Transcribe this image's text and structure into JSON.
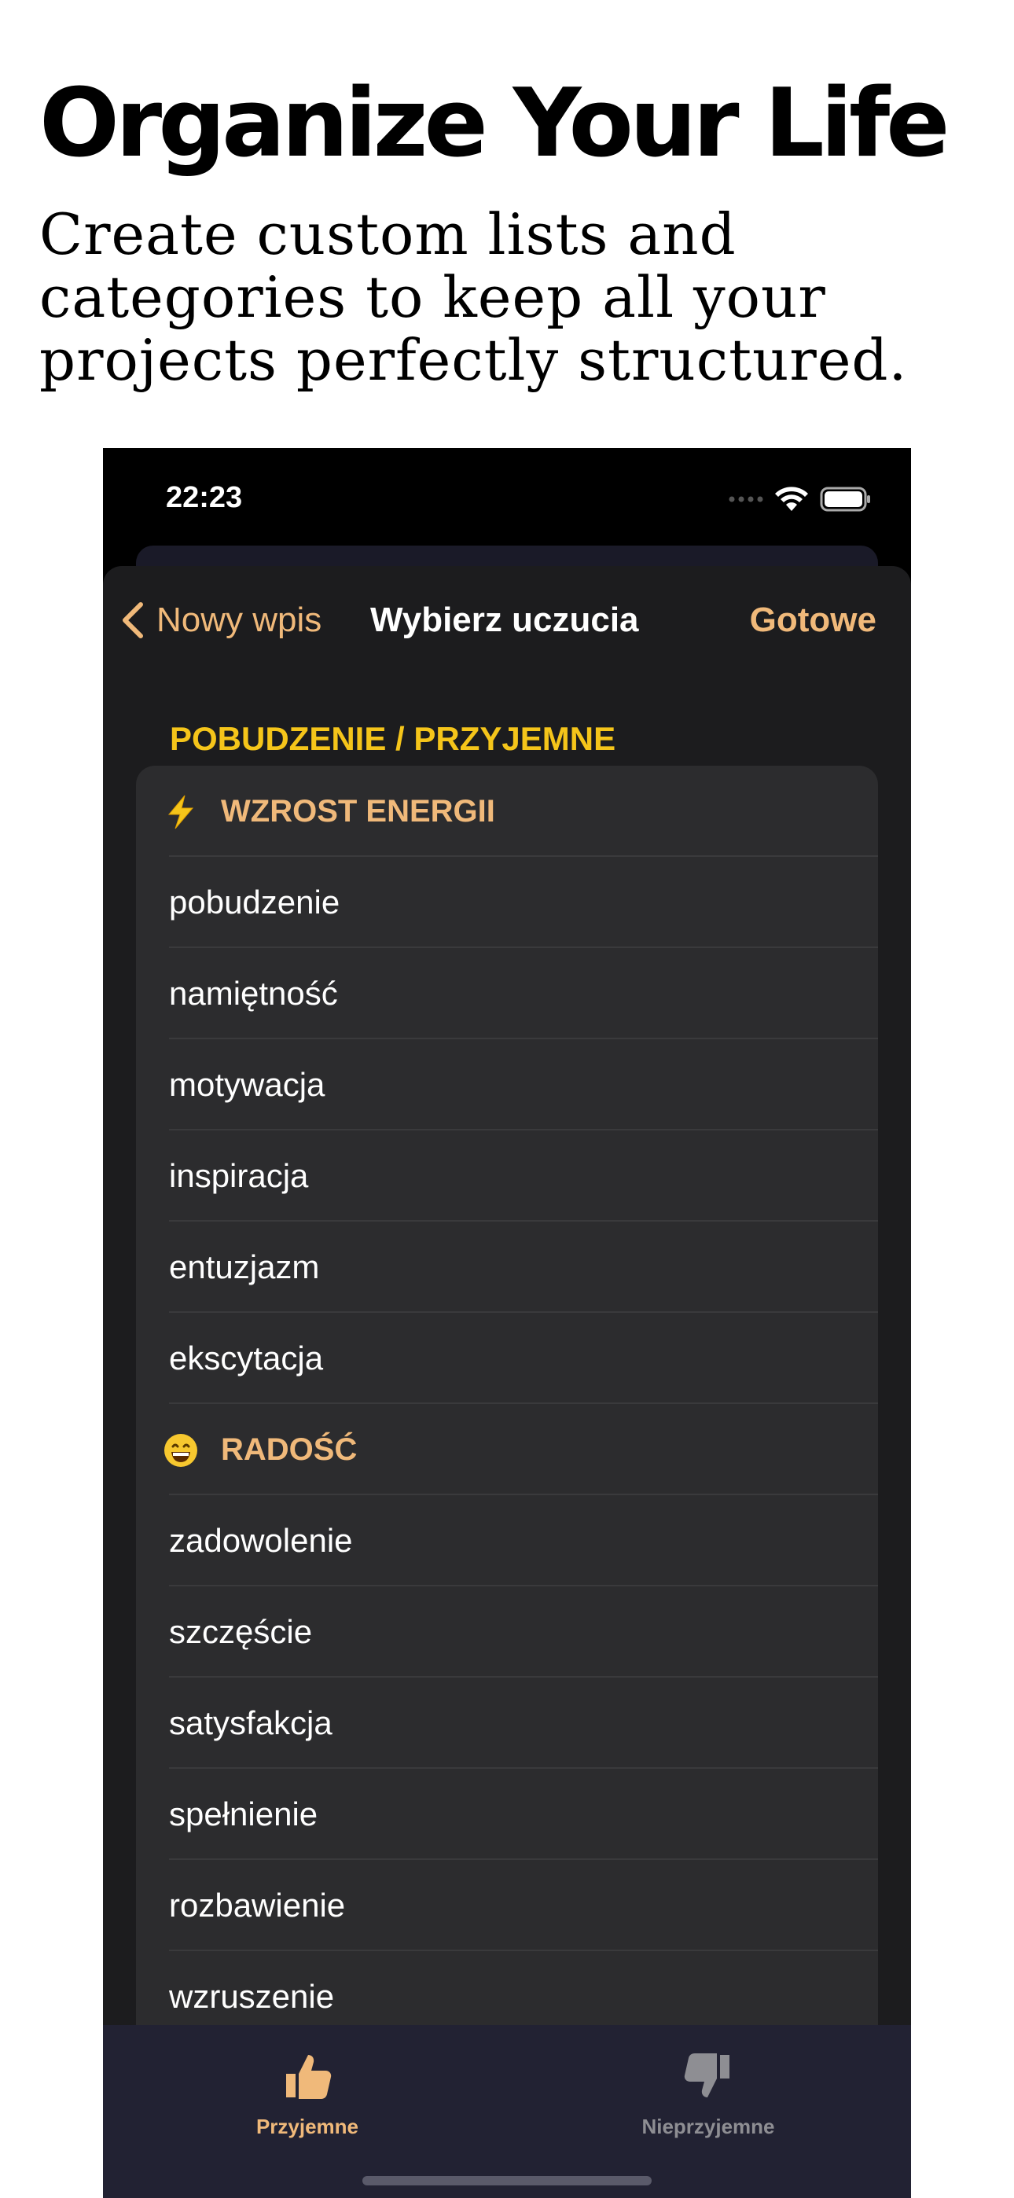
{
  "marketing": {
    "headline": "Organize Your Life",
    "subheadline": "Create custom lists and categories to keep all your projects perfectly structured."
  },
  "status_bar": {
    "time": "22:23"
  },
  "nav": {
    "back_label": "Nowy wpis",
    "title": "Wybierz uczucia",
    "done_label": "Gotowe"
  },
  "section": {
    "title": "POBUDZENIE / PRZYJEMNE"
  },
  "rows": [
    {
      "type": "header",
      "icon": "lightning-icon",
      "label": "WZROST ENERGII"
    },
    {
      "type": "item",
      "label": "pobudzenie"
    },
    {
      "type": "item",
      "label": "namiętność"
    },
    {
      "type": "item",
      "label": "motywacja"
    },
    {
      "type": "item",
      "label": "inspiracja"
    },
    {
      "type": "item",
      "label": "entuzjazm"
    },
    {
      "type": "item",
      "label": "ekscytacja"
    },
    {
      "type": "header",
      "icon": "grinning-face-icon",
      "label": "RADOŚĆ"
    },
    {
      "type": "item",
      "label": "zadowolenie"
    },
    {
      "type": "item",
      "label": "szczęście"
    },
    {
      "type": "item",
      "label": "satysfakcja"
    },
    {
      "type": "item",
      "label": "spełnienie"
    },
    {
      "type": "item",
      "label": "rozbawienie"
    },
    {
      "type": "item",
      "label": "wzruszenie"
    }
  ],
  "tabbar": {
    "tabs": [
      {
        "label": "Przyjemne",
        "icon": "thumbs-up-icon",
        "active": true
      },
      {
        "label": "Nieprzyjemne",
        "icon": "thumbs-down-icon",
        "active": false
      }
    ]
  },
  "colors": {
    "accent": "#f0b97a",
    "section_title": "#f5c51a",
    "sheet_bg": "#1c1c1e",
    "group_bg": "#2c2c2e",
    "tabbar_bg": "#222233",
    "tab_inactive": "#8e8e93"
  }
}
